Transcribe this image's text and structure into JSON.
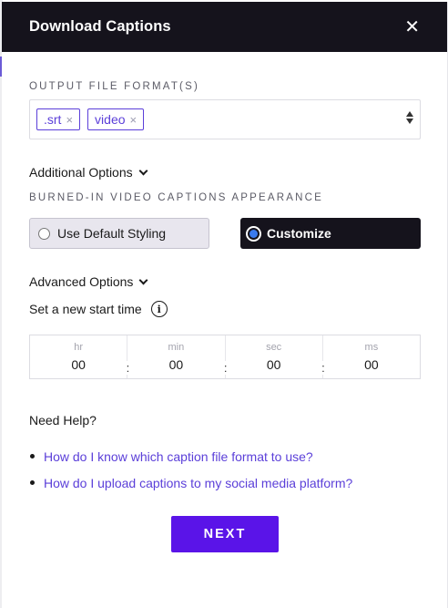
{
  "header": {
    "title": "Download Captions",
    "close_icon": "close-icon"
  },
  "output_format": {
    "label": "OUTPUT FILE FORMAT(S)",
    "selected": [
      {
        "label": ".srt",
        "remove": "×"
      },
      {
        "label": "video",
        "remove": "×"
      }
    ]
  },
  "additional_options": {
    "label": "Additional Options"
  },
  "burned_in": {
    "label": "BURNED-IN VIDEO CAPTIONS APPEARANCE",
    "options": [
      {
        "label": "Use Default Styling",
        "selected": false
      },
      {
        "label": "Customize",
        "selected": true
      }
    ]
  },
  "advanced_options": {
    "label": "Advanced Options"
  },
  "start_time": {
    "label": "Set a new start time",
    "info_icon": "i",
    "fields": [
      {
        "unit": "hr",
        "value": "00",
        "sep": ":"
      },
      {
        "unit": "min",
        "value": "00",
        "sep": ":"
      },
      {
        "unit": "sec",
        "value": "00",
        "sep": ":"
      },
      {
        "unit": "ms",
        "value": "00",
        "sep": ""
      }
    ]
  },
  "help": {
    "title": "Need Help?",
    "links": [
      "How do I know which caption file format to use?",
      "How do I upload captions to my social media platform?"
    ]
  },
  "next_button": {
    "label": "NEXT"
  },
  "colors": {
    "header_bg": "#15131c",
    "accent": "#5b3fd9",
    "button": "#5a14e8",
    "radio_selected": "#3a7bf0"
  }
}
